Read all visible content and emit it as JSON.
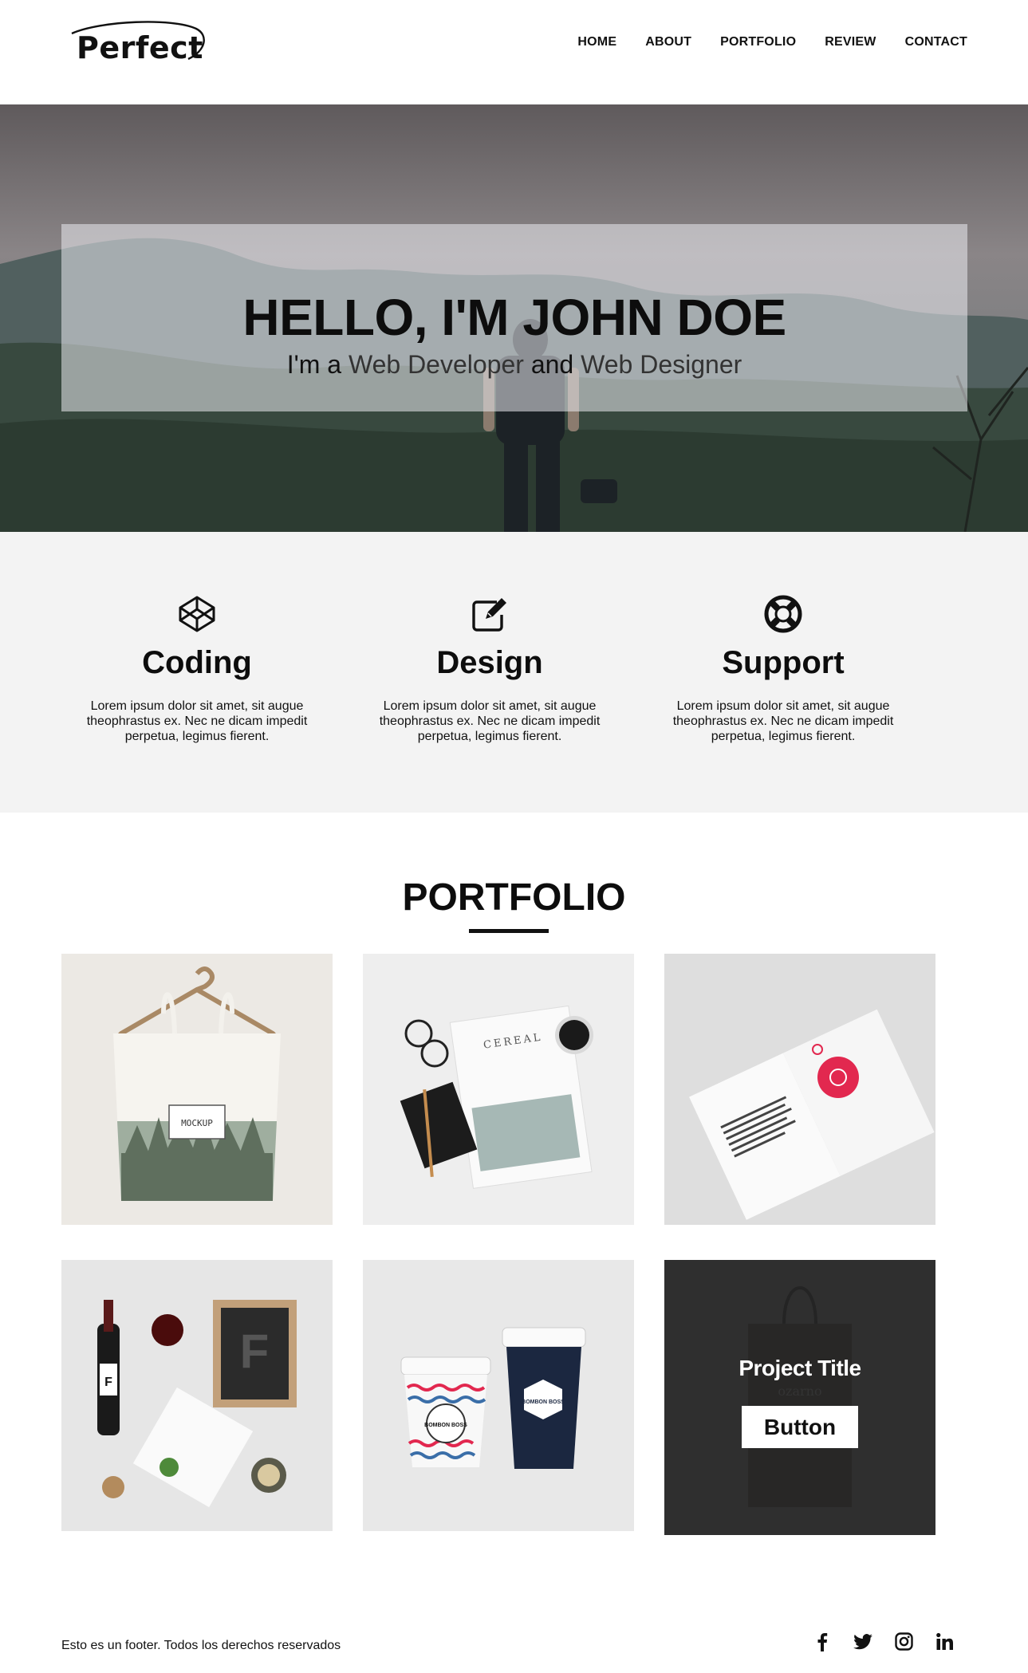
{
  "brand": {
    "logo_text": "Perfect"
  },
  "nav": {
    "items": [
      {
        "label": "HOME"
      },
      {
        "label": "ABOUT"
      },
      {
        "label": "PORTFOLIO"
      },
      {
        "label": "REVIEW"
      },
      {
        "label": "CONTACT"
      }
    ]
  },
  "hero": {
    "title": "HELLO, I'M JOHN DOE",
    "sub_prefix": "I'm a ",
    "sub_role1": "Web Developer",
    "sub_and": " and ",
    "sub_role2": "Web Designer"
  },
  "services": [
    {
      "icon": "codepen-icon",
      "title": "Coding",
      "text": "Lorem ipsum dolor sit amet, sit augue theophrastus ex. Nec ne dicam impedit perpetua, legimus fierent."
    },
    {
      "icon": "edit-icon",
      "title": "Design",
      "text": "Lorem ipsum dolor sit amet, sit augue theophrastus ex. Nec ne dicam impedit perpetua, legimus fierent."
    },
    {
      "icon": "life-ring-icon",
      "title": "Support",
      "text": "Lorem ipsum dolor sit amet, sit augue theophrastus ex. Nec ne dicam impedit perpetua, legimus fierent."
    }
  ],
  "portfolio": {
    "title": "PORTFOLIO",
    "tile_texts": {
      "bag_label": "MOCKUP",
      "magazine_label": "CEREAL",
      "cup_label": "BOMBON BOSS",
      "card_letter": "F",
      "bag_brand": "ozarno"
    },
    "overlay": {
      "title": "Project Title",
      "button": "Button"
    }
  },
  "footer": {
    "text": "Esto es un footer. Todos los derechos reservados",
    "social": [
      "facebook-icon",
      "twitter-icon",
      "instagram-icon",
      "linkedin-icon"
    ]
  },
  "colors": {
    "text": "#111111",
    "services_bg": "#f3f3f3",
    "overlay_bg": "#2b2b2b",
    "accent_red": "#e2284f"
  }
}
